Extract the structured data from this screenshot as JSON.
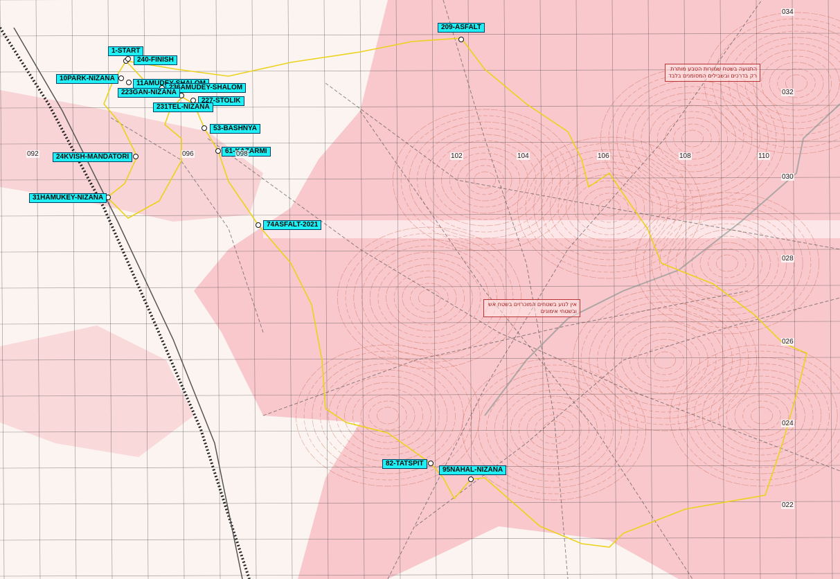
{
  "map": {
    "colors": {
      "base": "#fbf4f1",
      "restricted_zone": "#f7b9bf",
      "contour": "#c8563a",
      "grid": "#3f3f3f",
      "trail": "#ecd21a",
      "label_bg": "#1ef0f5",
      "label_border": "#003c60"
    },
    "grid_x_labels": [
      "092",
      "096",
      "098",
      "102",
      "104",
      "106",
      "108",
      "110"
    ],
    "grid_y_labels": [
      "034",
      "032",
      "030",
      "028",
      "026",
      "024",
      "022"
    ],
    "annotations": [
      "התנועה בשטח שמורות הטבע מותרת רק בדרכים ובשבילים המסומנים בלבד",
      "אין לנוע בשטחים המוכרזים בשטח אש ובשטחי אימונים"
    ]
  },
  "waypoints": [
    {
      "name": "1-START"
    },
    {
      "name": "240-FINISH"
    },
    {
      "name": "10PARK-NIZANA"
    },
    {
      "name": "11AMUDEY-SHALOM"
    },
    {
      "name": "236AMUDEY-SHALOM"
    },
    {
      "name": "223GAN-NIZANA"
    },
    {
      "name": "227-STOLIK"
    },
    {
      "name": "231TEL-NIZANA"
    },
    {
      "name": "53-BASHNYA"
    },
    {
      "name": "61-KAZARMI"
    },
    {
      "name": "24KVISH-MANDATORI"
    },
    {
      "name": "31HAMUKEY-NIZANA"
    },
    {
      "name": "74ASFALT-2021"
    },
    {
      "name": "209-ASFALT"
    },
    {
      "name": "82-TATSPIT"
    },
    {
      "name": "95NAHAL-NIZANA"
    }
  ]
}
